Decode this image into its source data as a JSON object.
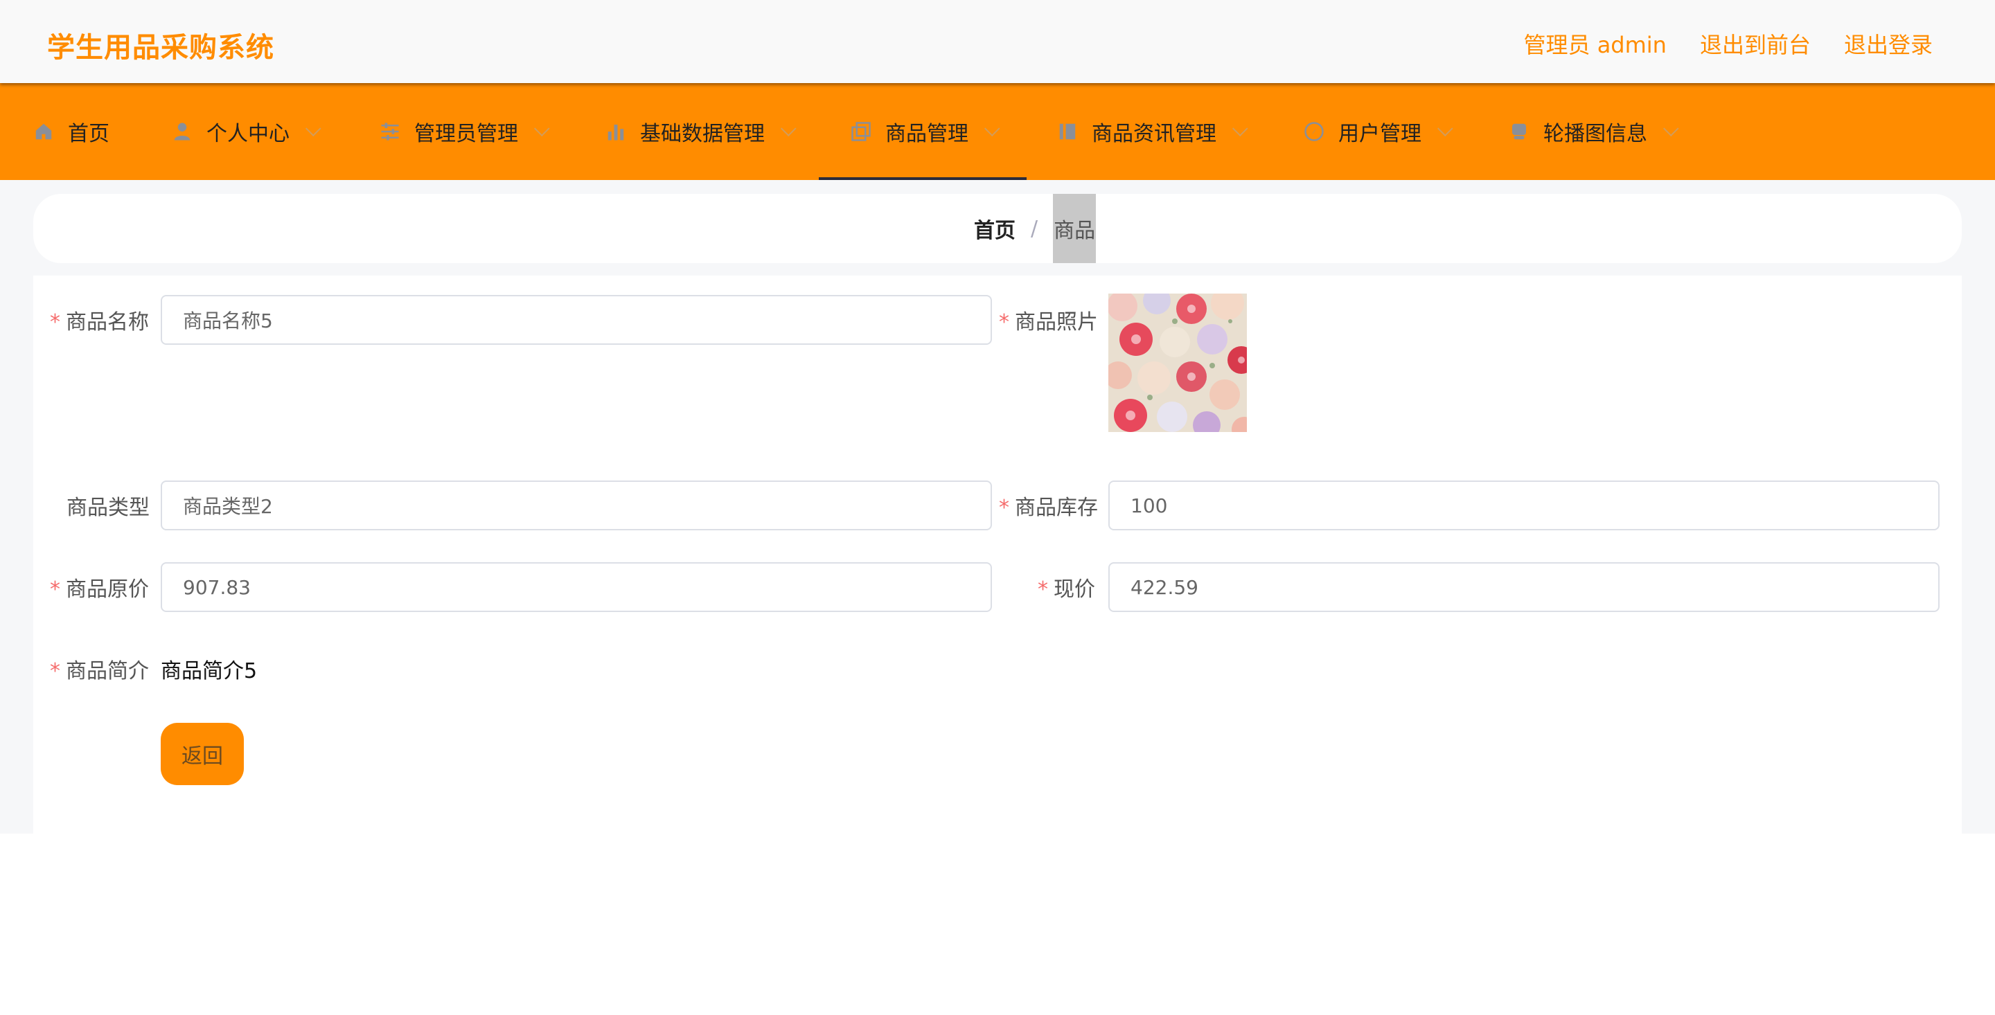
{
  "header": {
    "brand": "学生用品采购系统",
    "user_label": "管理员 admin",
    "to_front": "退出到前台",
    "logout": "退出登录"
  },
  "nav": {
    "items": [
      {
        "label": "首页",
        "icon": "home-icon",
        "has_dropdown": false
      },
      {
        "label": "个人中心",
        "icon": "user-icon",
        "has_dropdown": true
      },
      {
        "label": "管理员管理",
        "icon": "sliders-icon",
        "has_dropdown": true
      },
      {
        "label": "基础数据管理",
        "icon": "bar-chart-icon",
        "has_dropdown": true
      },
      {
        "label": "商品管理",
        "icon": "copy-icon",
        "has_dropdown": true,
        "active": true
      },
      {
        "label": "商品资讯管理",
        "icon": "news-icon",
        "has_dropdown": true
      },
      {
        "label": "用户管理",
        "icon": "compass-icon",
        "has_dropdown": true
      },
      {
        "label": "轮播图信息",
        "icon": "layers-icon",
        "has_dropdown": true
      }
    ]
  },
  "breadcrumb": {
    "home": "首页",
    "separator": "/",
    "current": "商品"
  },
  "form": {
    "name_label": "商品名称",
    "name_value": "商品名称5",
    "photo_label": "商品照片",
    "type_label": "商品类型",
    "type_value": "商品类型2",
    "stock_label": "商品库存",
    "stock_value": "100",
    "orig_price_label": "商品原价",
    "orig_price_value": "907.83",
    "price_label": "现价",
    "price_value": "422.59",
    "intro_label": "商品简介",
    "intro_value": "商品简介5",
    "required_mark": "*",
    "back_button": "返回"
  },
  "colors": {
    "accent": "#ff8c00",
    "required": "#f56c6c"
  }
}
